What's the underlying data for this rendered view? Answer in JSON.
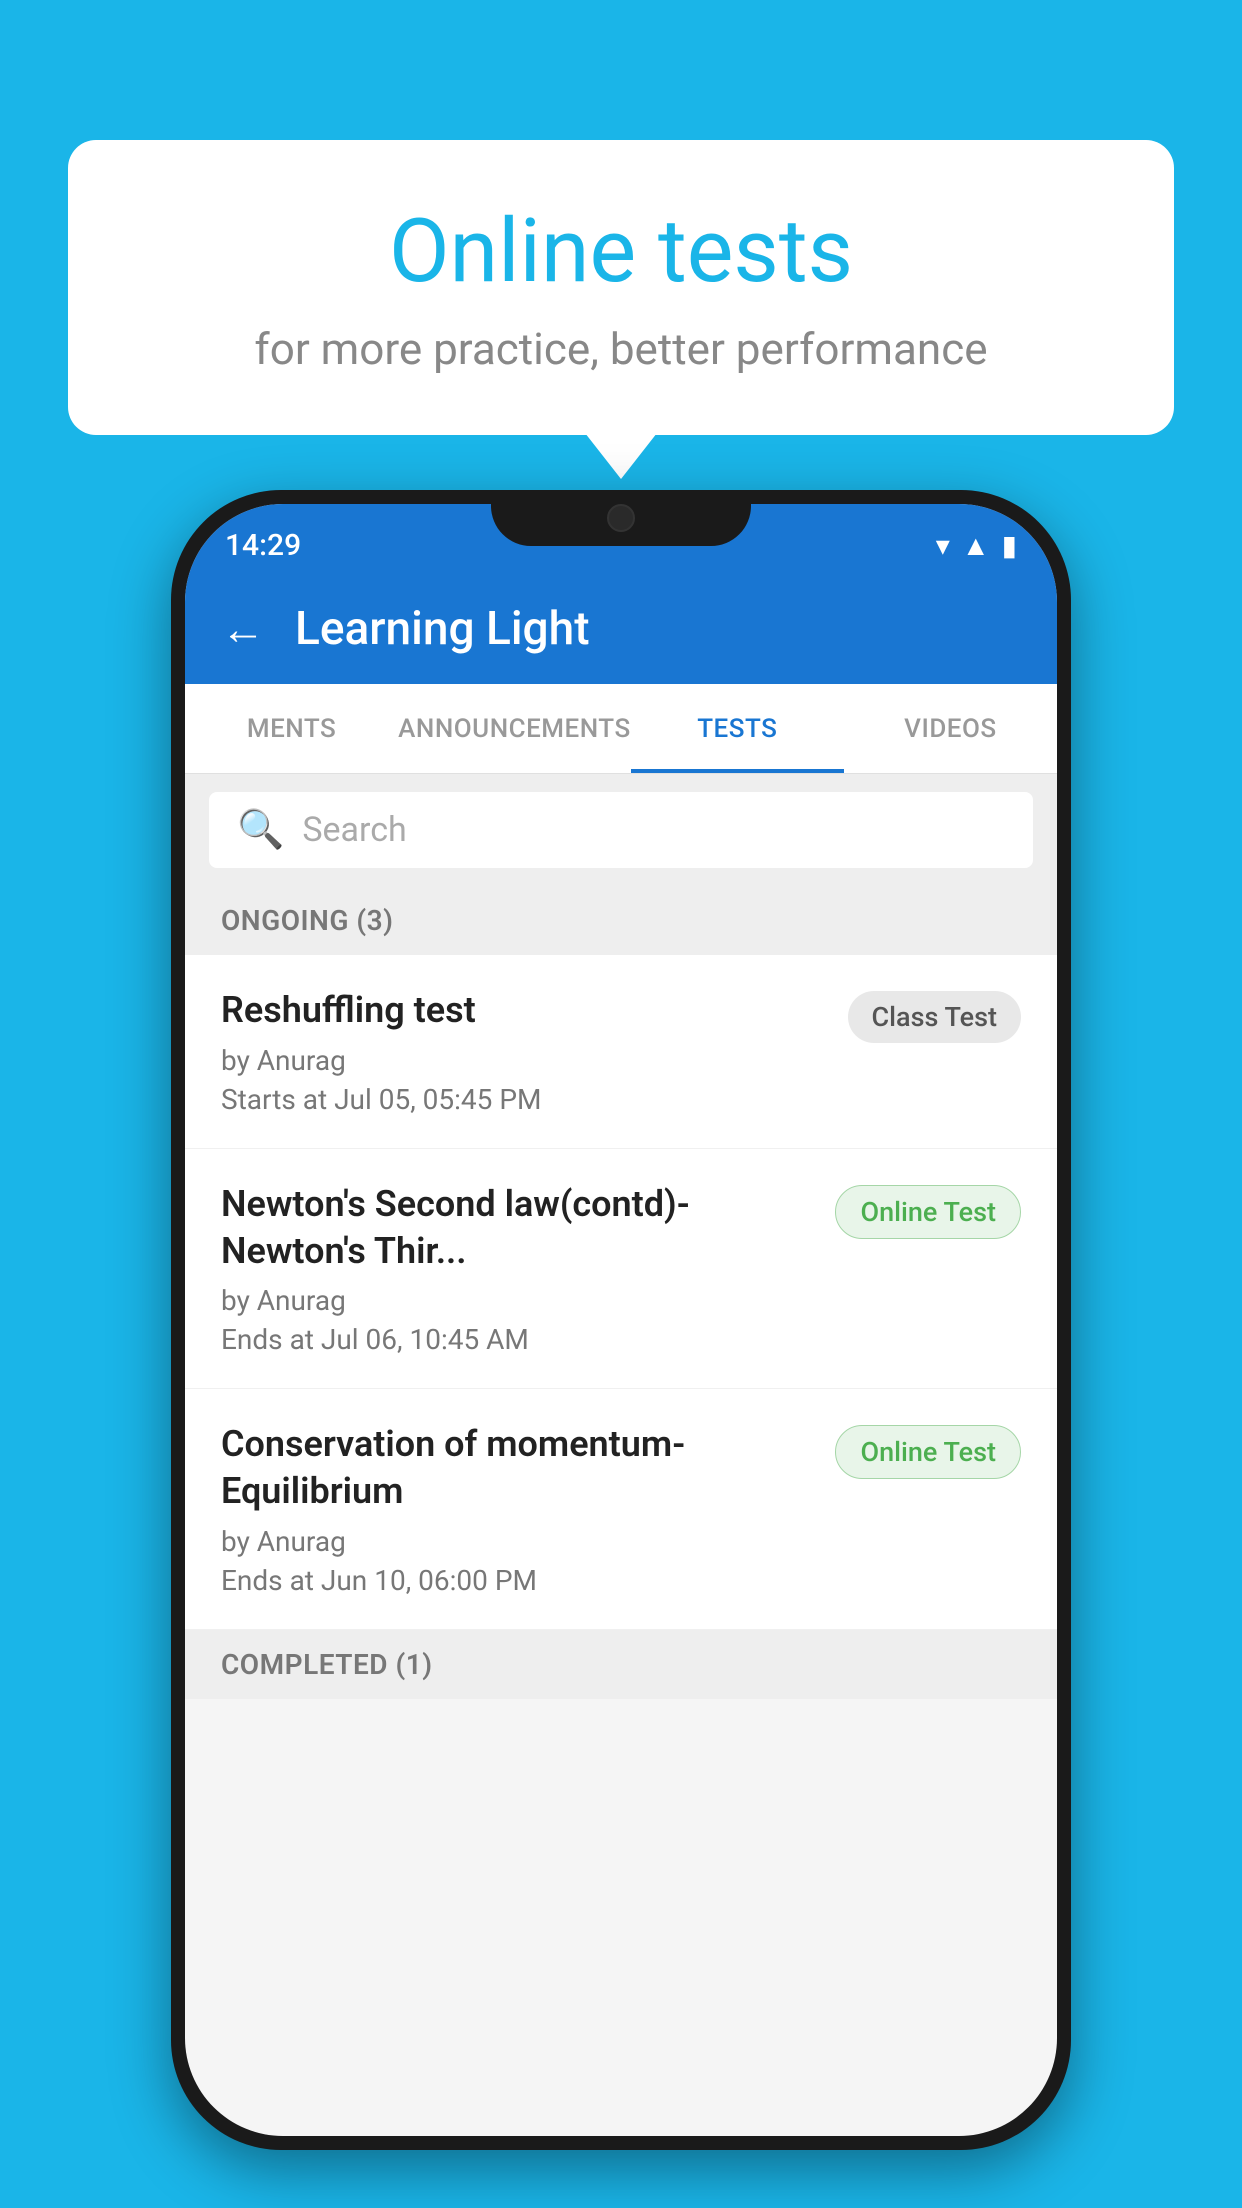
{
  "background": {
    "color": "#1ab5e8"
  },
  "speech_bubble": {
    "title": "Online tests",
    "subtitle": "for more practice, better performance"
  },
  "phone": {
    "status_bar": {
      "time": "14:29"
    },
    "app_bar": {
      "title": "Learning Light",
      "back_label": "←"
    },
    "tabs": [
      {
        "label": "MENTS",
        "active": false
      },
      {
        "label": "ANNOUNCEMENTS",
        "active": false
      },
      {
        "label": "TESTS",
        "active": true
      },
      {
        "label": "VIDEOS",
        "active": false
      }
    ],
    "search": {
      "placeholder": "Search"
    },
    "ongoing_section": {
      "label": "ONGOING (3)"
    },
    "tests": [
      {
        "name": "Reshuffling test",
        "author": "by Anurag",
        "time_label": "Starts at",
        "time": "Jul 05, 05:45 PM",
        "badge": "Class Test",
        "badge_type": "class"
      },
      {
        "name": "Newton's Second law(contd)-Newton's Thir...",
        "author": "by Anurag",
        "time_label": "Ends at",
        "time": "Jul 06, 10:45 AM",
        "badge": "Online Test",
        "badge_type": "online"
      },
      {
        "name": "Conservation of momentum-Equilibrium",
        "author": "by Anurag",
        "time_label": "Ends at",
        "time": "Jun 10, 06:00 PM",
        "badge": "Online Test",
        "badge_type": "online"
      }
    ],
    "completed_section": {
      "label": "COMPLETED (1)"
    }
  }
}
